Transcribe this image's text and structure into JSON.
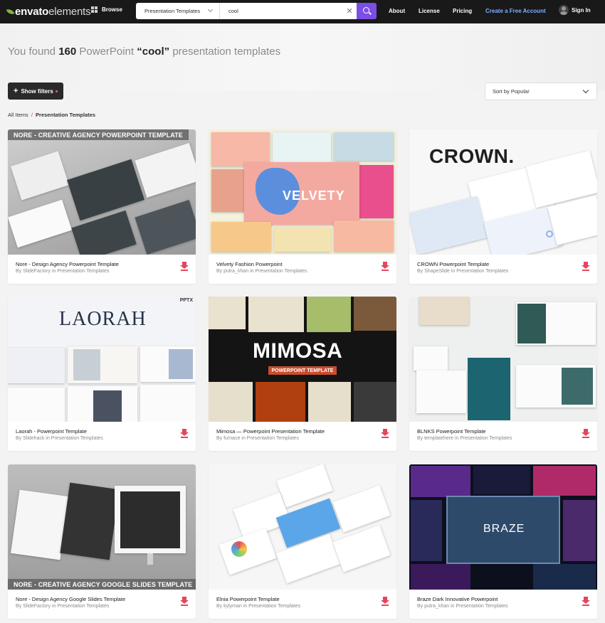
{
  "nav": {
    "logo_bold": "envato",
    "logo_light": "elements",
    "browse_label": "Browse",
    "search_category": "Presentation Templates",
    "search_query": "cool",
    "links": [
      "About",
      "License",
      "Pricing"
    ],
    "cta": "Create a Free Account",
    "signin": "Sign In"
  },
  "headline": {
    "prefix": "You found",
    "count": "160",
    "middle": "PowerPoint",
    "term": "“cool”",
    "suffix": "presentation templates"
  },
  "filters": {
    "show_filters_label": "Show filters"
  },
  "sort": {
    "selected": "Sort by Popular"
  },
  "breadcrumb": {
    "root": "All Items",
    "separator": "/",
    "current": "Presentation Templates"
  },
  "cards": [
    {
      "title": "Nore - Design Agency Powerpoint Template",
      "byline": "By SlideFactory in Presentation Templates",
      "banner": "NORE - CREATIVE AGENCY POWERPOINT TEMPLATE"
    },
    {
      "title": "Velvety Fashion Powerpoint",
      "byline": "By putra_khan in Presentation Templates",
      "word": "VELVETY"
    },
    {
      "title": "CROWN Powerpoint Template",
      "byline": "By ShapeSlide in Presentation Templates",
      "word": "CROWN."
    },
    {
      "title": "Laorah - Powerpoint Template",
      "byline": "By Slidehack in Presentation Templates",
      "word": "LAORAH",
      "tag": "PPTX"
    },
    {
      "title": "Mimosa — Powerpoint Presentation Template",
      "byline": "By furnace in Presentation Templates",
      "word": "MIMOSA",
      "subword": "POWERPOINT TEMPLATE"
    },
    {
      "title": "BLNKS Powerpoint Template",
      "byline": "By templatehere in Presentation Templates"
    },
    {
      "title": "Nore - Design Agency Google Slides Template",
      "byline": "By SlideFactory in Presentation Templates",
      "banner": "NORE - CREATIVE AGENCY GOOGLE SLIDES TEMPLATE"
    },
    {
      "title": "Elnia Powerpoint Template",
      "byline": "By kylyman in Presentation Templates"
    },
    {
      "title": "Braze Dark Innovative Powerpoint",
      "byline": "By putra_khan in Presentation Templates",
      "word": "BRAZE"
    }
  ],
  "colors": {
    "accent": "#7b4fe3",
    "download": "#e3465d",
    "nav_bg": "#191919",
    "cta": "#7bb0ff"
  }
}
